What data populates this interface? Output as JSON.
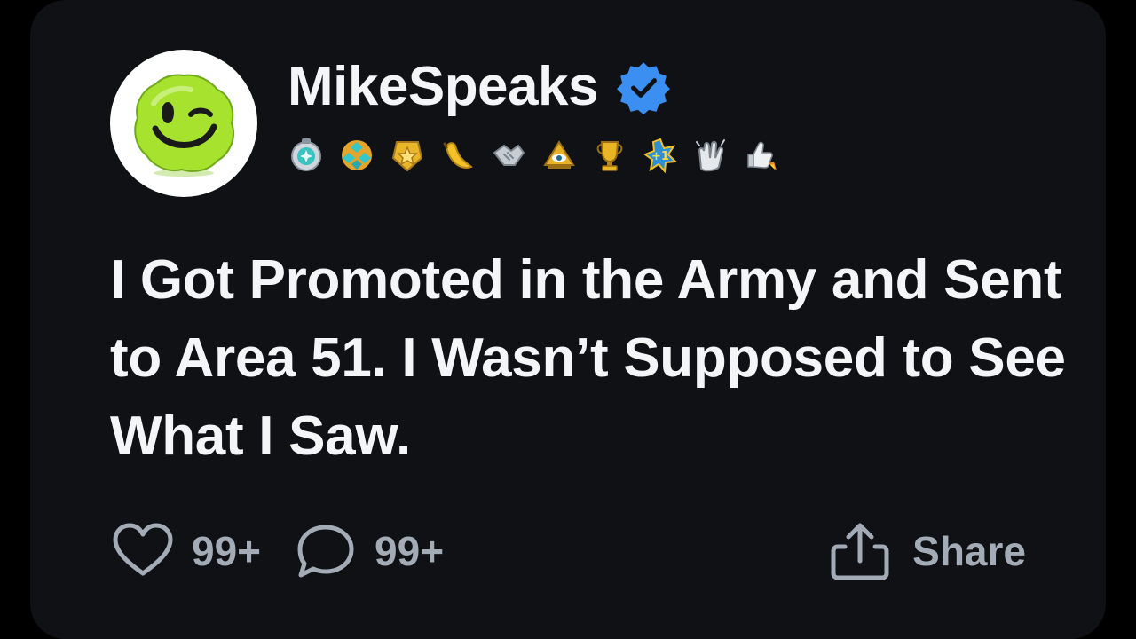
{
  "post": {
    "author": {
      "name": "MikeSpeaks",
      "verified": true,
      "avatar_icon": "winking-smiley-icon"
    },
    "badges": [
      "medal-icon",
      "gem-cluster-icon",
      "gold-star-icon",
      "banana-icon",
      "handshake-icon",
      "pyramid-eye-icon",
      "trophy-icon",
      "plus-one-icon",
      "clapping-hands-icon",
      "thumbs-up-rocket-icon"
    ],
    "title": "I Got Promoted in the Army and Sent to Area 51. I Wasn’t Supposed to See What I Saw.",
    "likes": "99+",
    "comments": "99+",
    "share_label": "Share"
  },
  "colors": {
    "background": "#000000",
    "card": "#0f1114",
    "text": "#f4f5f6",
    "muted": "#a3acb6",
    "verified_blue": "#3b8ff0",
    "avatar_green": "#9ddc2e"
  }
}
